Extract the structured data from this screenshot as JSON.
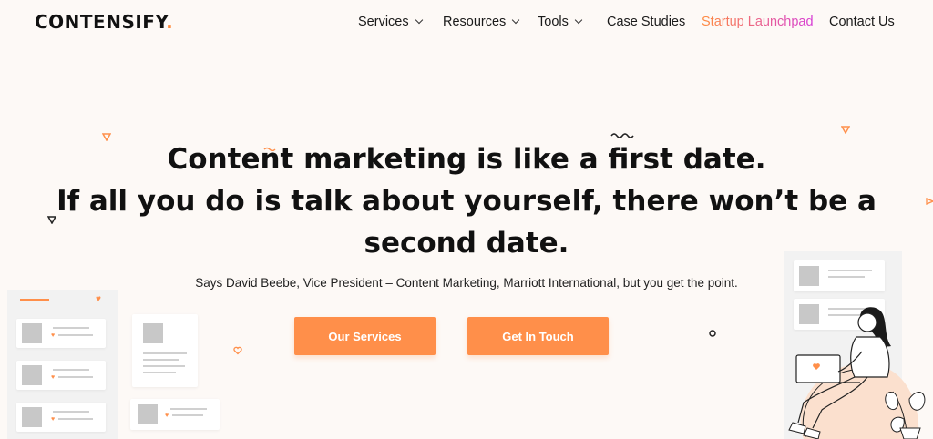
{
  "header": {
    "logo_text": "CONTENSIFY",
    "logo_dot": ".",
    "nav": [
      {
        "label": "Services",
        "dropdown": true
      },
      {
        "label": "Resources",
        "dropdown": true
      },
      {
        "label": "Tools",
        "dropdown": true
      },
      {
        "label": "Case Studies",
        "dropdown": false
      },
      {
        "label": "Startup Launchpad",
        "dropdown": false
      },
      {
        "label": "Contact Us",
        "dropdown": false
      }
    ]
  },
  "hero": {
    "title_lines": [
      "Content marketing is like a first date.",
      "If all you do is talk about yourself, there won’t be a",
      "second date."
    ],
    "subtitle": "Says David Beebe, Vice President – Content Marketing, Marriott International, but you get the point.",
    "buttons": {
      "primary": "Our Services",
      "secondary": "Get In Touch"
    }
  },
  "colors": {
    "accent": "#ff8f4a",
    "background": "#fdf9f6",
    "launchpad_gradient": [
      "#ff8b3d",
      "#d63bd6"
    ]
  },
  "icons": [
    "chevron-down-icon",
    "heart-icon",
    "triangle-icon",
    "squiggle-icon",
    "circle-icon"
  ]
}
